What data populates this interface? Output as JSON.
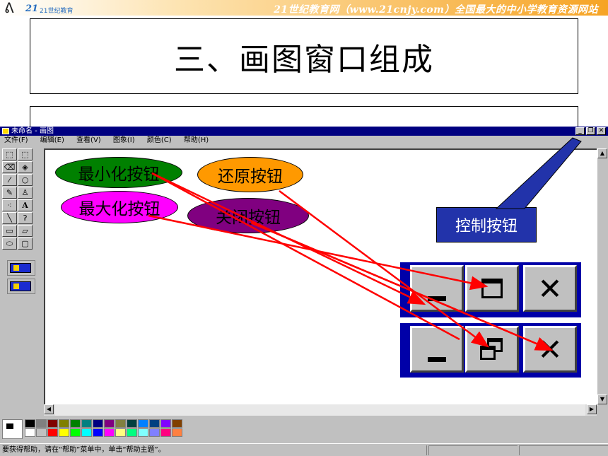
{
  "banner": {
    "site_text": "21世纪教育网（www.21cnjy.com）全国最大的中小学教育资源网站",
    "logo_text": "21世纪教育"
  },
  "slide": {
    "title": "三、画图窗口组成"
  },
  "window": {
    "title": "未命名 - 画图",
    "menu": [
      "文件(F)",
      "编辑(E)",
      "查看(V)",
      "图象(I)",
      "颜色(C)",
      "帮助(H)"
    ],
    "status_text": "要获得帮助，请在“帮助”菜单中，单击“帮助主题”。",
    "tools": [
      {
        "icon": "free-select-icon",
        "glyph": "⬚"
      },
      {
        "icon": "rect-select-icon",
        "glyph": "⬚"
      },
      {
        "icon": "eraser-icon",
        "glyph": "⌫"
      },
      {
        "icon": "fill-icon",
        "glyph": "◈"
      },
      {
        "icon": "eyedropper-icon",
        "glyph": "⁄"
      },
      {
        "icon": "magnifier-icon",
        "glyph": "🔍"
      },
      {
        "icon": "pencil-icon",
        "glyph": "✎"
      },
      {
        "icon": "brush-icon",
        "glyph": "♙"
      },
      {
        "icon": "airbrush-icon",
        "glyph": "⁖"
      },
      {
        "icon": "text-icon",
        "glyph": "A"
      },
      {
        "icon": "line-icon",
        "glyph": "╲"
      },
      {
        "icon": "curve-icon",
        "glyph": "ʔ"
      },
      {
        "icon": "rectangle-icon",
        "glyph": "▭"
      },
      {
        "icon": "polygon-icon",
        "glyph": "▱"
      },
      {
        "icon": "ellipse-icon",
        "glyph": "⬭"
      },
      {
        "icon": "rounded-rect-icon",
        "glyph": "▢"
      }
    ],
    "palette_top": [
      "#000000",
      "#808080",
      "#800000",
      "#808000",
      "#008000",
      "#008080",
      "#000080",
      "#800080",
      "#808040",
      "#004040",
      "#0080ff",
      "#004080",
      "#8000ff",
      "#804000"
    ],
    "palette_bottom": [
      "#ffffff",
      "#c0c0c0",
      "#ff0000",
      "#ffff00",
      "#00ff00",
      "#00ffff",
      "#0000ff",
      "#ff00ff",
      "#ffff80",
      "#00ff80",
      "#80ffff",
      "#8080ff",
      "#ff0080",
      "#ff8040"
    ]
  },
  "callouts": {
    "minimize": {
      "label": "最小化按钮",
      "color": "#008000"
    },
    "restore": {
      "label": "还原按钮",
      "color": "#ff9900"
    },
    "maximize": {
      "label": "最大化按钮",
      "color": "#ff00ff"
    },
    "close": {
      "label": "关闭按钮",
      "color": "#800080"
    },
    "control": {
      "label": "控制按钮",
      "color": "#2233aa"
    }
  },
  "zoomed_buttons": {
    "top_row": [
      "minimize-icon",
      "maximize-icon",
      "close-icon"
    ],
    "bottom_row": [
      "minimize-icon",
      "restore-icon",
      "close-icon"
    ]
  },
  "colors": {
    "arrow": "#ff0000",
    "titlebar": "#000080"
  }
}
